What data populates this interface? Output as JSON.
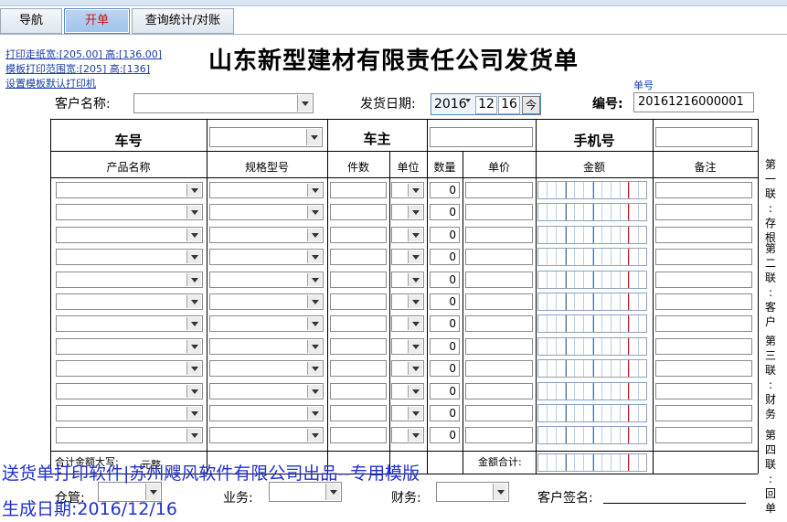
{
  "tabs": [
    {
      "label": "导航"
    },
    {
      "label": "开单"
    },
    {
      "label": "查询统计/对账"
    }
  ],
  "print_links": {
    "paper": "打印走纸宽:[205.00] 高:[136.00]",
    "template_range": "模板打印范围宽:[205] 高:[136]",
    "default_printer": "设置模板默认打印机"
  },
  "title": "山东新型建材有限责任公司发货单",
  "header": {
    "customer_label": "客户名称:",
    "customer_value": "",
    "ship_date_label": "发货日期:",
    "year": "2016",
    "month": "12",
    "day": "16",
    "today_btn": "今",
    "number_caption": "单号",
    "number_label": "编号:",
    "number_value": "20161216000001"
  },
  "table": {
    "row1": {
      "vehicle": "车号",
      "owner": "车主",
      "phone": "手机号"
    },
    "columns": [
      "产品名称",
      "规格型号",
      "件数",
      "单位",
      "数量",
      "单价",
      "金额",
      "备注"
    ],
    "rows": [
      {
        "qty": "0"
      },
      {
        "qty": "0"
      },
      {
        "qty": "0"
      },
      {
        "qty": "0"
      },
      {
        "qty": "0"
      },
      {
        "qty": "0"
      },
      {
        "qty": "0"
      },
      {
        "qty": "0"
      },
      {
        "qty": "0"
      },
      {
        "qty": "0"
      },
      {
        "qty": "0"
      },
      {
        "qty": "0"
      }
    ],
    "total_upper_label": "合计金额大写:",
    "total_upper_unit": "元整",
    "total_label": "金额合计:"
  },
  "footer": {
    "warehouse_label": "仓管:",
    "sales_label": "业务:",
    "finance_label": "财务:",
    "sign_label": "客户签名:"
  },
  "side_labels": {
    "copy1": [
      "第",
      "一",
      "联",
      ":",
      "存",
      "根"
    ],
    "copy2": [
      "第",
      "二",
      "联",
      ":",
      "客",
      "户"
    ],
    "copy3": [
      "第",
      "三",
      "联",
      ":",
      "财",
      "务"
    ],
    "copy4": [
      "第",
      "四",
      "联",
      ":",
      "回",
      "单"
    ]
  },
  "watermark": {
    "line1": "送货单打印软件|苏州飕风软件有限公司出品--专用模版",
    "line2": "生成日期:2016/12/16"
  },
  "colors": {
    "accent_red": "#d01010",
    "watermark_blue": "#1f2fd0",
    "link_blue": "#1a3fa6"
  }
}
